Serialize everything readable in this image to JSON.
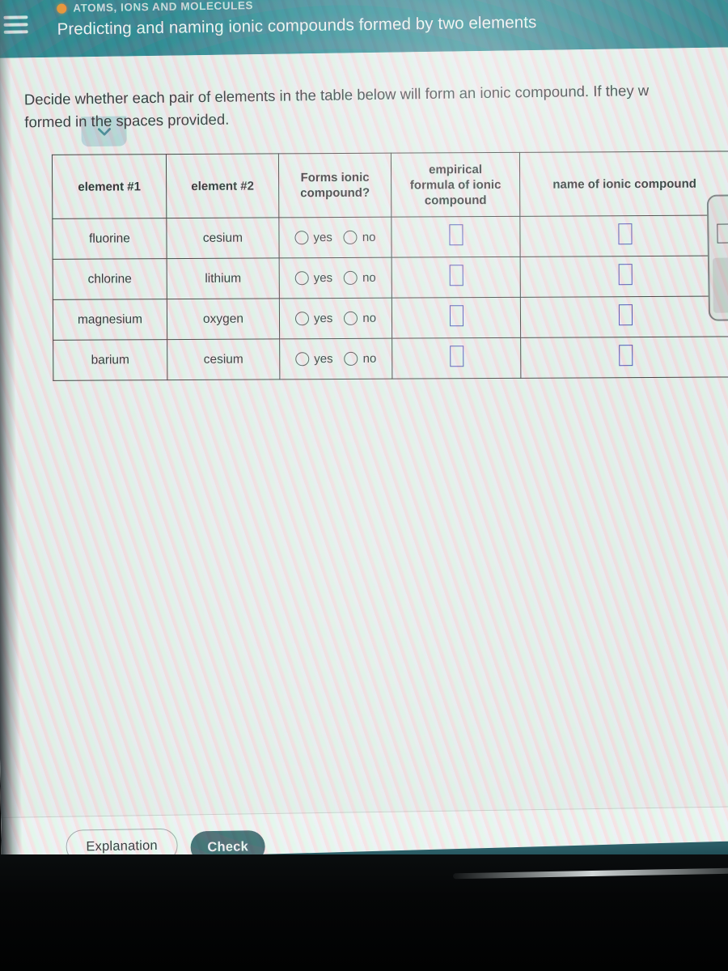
{
  "appbar": {
    "menu_icon": "hamburger-icon",
    "status_dot_color": "#ee8b22",
    "eyebrow": "ATOMS, IONS AND MOLECULES",
    "title": "Predicting and naming ionic compounds formed by two elements",
    "bar_color": "#1d7b89"
  },
  "collapse_tab": {
    "icon": "chevron-down-icon",
    "color": "#b7d2d6"
  },
  "prompt": {
    "line1": "Decide whether each pair of elements in the table below will form an ionic compound. If they w",
    "line2": "formed in the spaces provided."
  },
  "table": {
    "headers": [
      "element #1",
      "element #2",
      "Forms ionic compound?",
      "empirical formula of ionic compound",
      "name of ionic compound"
    ],
    "header_lines": {
      "h1": [
        "element #1"
      ],
      "h2": [
        "element #2"
      ],
      "h3": [
        "Forms ionic",
        "compound?"
      ],
      "h4": [
        "empirical",
        "formula of ionic",
        "compound"
      ],
      "h5": [
        "name of ionic compound"
      ]
    },
    "radio_labels": {
      "yes": "yes",
      "no": "no"
    },
    "input_border_color": "#3b3fb0",
    "rows": [
      {
        "element1": "fluorine",
        "element2": "cesium",
        "forms": "",
        "formula": "",
        "name": ""
      },
      {
        "element1": "chlorine",
        "element2": "lithium",
        "forms": "",
        "formula": "",
        "name": ""
      },
      {
        "element1": "magnesium",
        "element2": "oxygen",
        "forms": "",
        "formula": "",
        "name": ""
      },
      {
        "element1": "barium",
        "element2": "cesium",
        "forms": "",
        "formula": "",
        "name": ""
      }
    ]
  },
  "footer": {
    "explanation_label": "Explanation",
    "check_label": "Check",
    "check_color": "#2d5c63"
  }
}
